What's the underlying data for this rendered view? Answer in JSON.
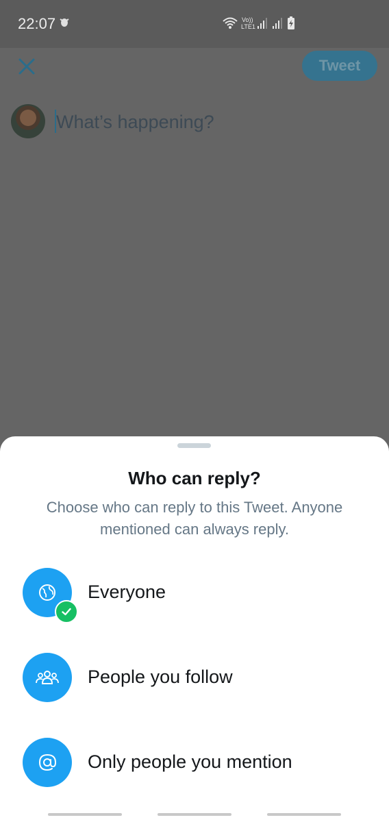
{
  "status_bar": {
    "time": "22:07",
    "network_label_top": "Vo))",
    "network_label_bottom": "LTE1",
    "icons": [
      "bug-icon",
      "wifi-icon",
      "signal-icon",
      "signal-icon",
      "battery-charging-icon"
    ]
  },
  "composer": {
    "close_icon": "close-icon",
    "tweet_button_label": "Tweet",
    "placeholder": "What’s happening?"
  },
  "reply_sheet": {
    "title": "Who can reply?",
    "subtitle": "Choose who can reply to this Tweet. Anyone mentioned can always reply.",
    "options": [
      {
        "label": "Everyone",
        "icon": "globe-icon",
        "selected": true
      },
      {
        "label": "People you follow",
        "icon": "people-icon",
        "selected": false
      },
      {
        "label": "Only people you mention",
        "icon": "at-sign-icon",
        "selected": false
      }
    ]
  },
  "colors": {
    "accent": "#1da1f2",
    "selected_check": "#17bf63",
    "overlay": "#656565",
    "title_text": "#14171a",
    "secondary_text": "#657786"
  }
}
